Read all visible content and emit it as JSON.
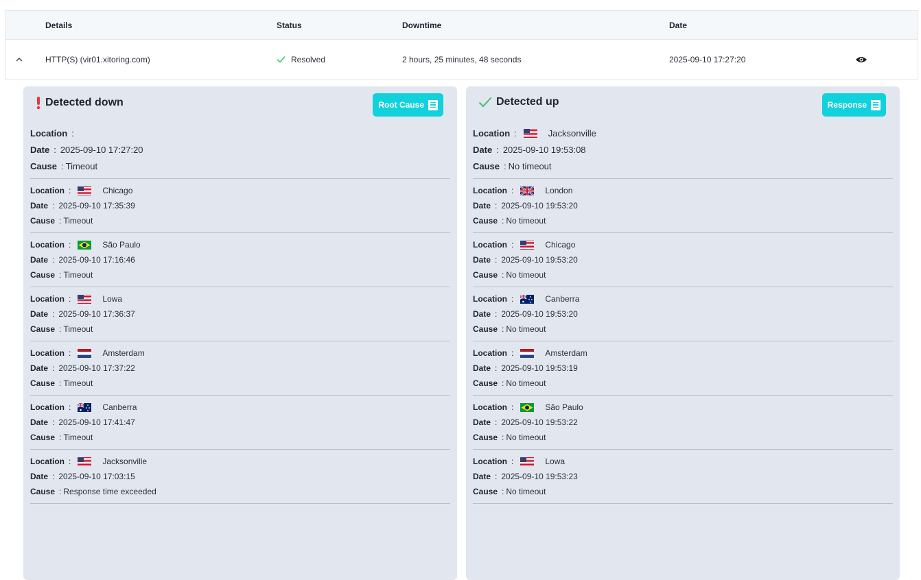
{
  "table": {
    "headers": {
      "details": "Details",
      "status": "Status",
      "downtime": "Downtime",
      "date": "Date"
    },
    "row": {
      "details": "HTTP(S) (vir01.xitoring.com)",
      "status": "Resolved",
      "downtime": "2 hours, 25 minutes, 48 seconds",
      "date": "2025-09-10 17:27:20",
      "expand_icon": "chevron-up-icon",
      "view_icon": "eye-icon",
      "status_icon": "check-icon"
    }
  },
  "labels": {
    "location": "Location",
    "date": "Date",
    "cause": "Cause",
    "sep": ":"
  },
  "down": {
    "title": "Detected down",
    "button": "Root Cause",
    "icon": "exclamation-icon",
    "entries": [
      {
        "location": "",
        "flag": "",
        "date": "2025-09-10 17:27:20",
        "cause": "Timeout"
      },
      {
        "location": "Chicago",
        "flag": "us",
        "date": "2025-09-10 17:35:39",
        "cause": "Timeout"
      },
      {
        "location": "São Paulo",
        "flag": "br",
        "date": "2025-09-10 17:16:46",
        "cause": "Timeout"
      },
      {
        "location": "Lowa",
        "flag": "us",
        "date": "2025-09-10 17:36:37",
        "cause": "Timeout"
      },
      {
        "location": "Amsterdam",
        "flag": "nl",
        "date": "2025-09-10 17:37:22",
        "cause": "Timeout"
      },
      {
        "location": "Canberra",
        "flag": "au",
        "date": "2025-09-10 17:41:47",
        "cause": "Timeout"
      },
      {
        "location": "Jacksonville",
        "flag": "us",
        "date": "2025-09-10 17:03:15",
        "cause": "Response time exceeded"
      }
    ]
  },
  "up": {
    "title": "Detected up",
    "button": "Response",
    "icon": "check-icon",
    "entries": [
      {
        "location": "Jacksonville",
        "flag": "us",
        "date": "2025-09-10 19:53:08",
        "cause": "No timeout"
      },
      {
        "location": "London",
        "flag": "gb",
        "date": "2025-09-10 19:53:20",
        "cause": "No timeout"
      },
      {
        "location": "Chicago",
        "flag": "us",
        "date": "2025-09-10 19:53:20",
        "cause": "No timeout"
      },
      {
        "location": "Canberra",
        "flag": "au",
        "date": "2025-09-10 19:53:20",
        "cause": "No timeout"
      },
      {
        "location": "Amsterdam",
        "flag": "nl",
        "date": "2025-09-10 19:53:19",
        "cause": "No timeout"
      },
      {
        "location": "São Paulo",
        "flag": "br",
        "date": "2025-09-10 19:53:22",
        "cause": "No timeout"
      },
      {
        "location": "Lowa",
        "flag": "us",
        "date": "2025-09-10 19:53:23",
        "cause": "No timeout"
      }
    ]
  },
  "colors": {
    "accent": "#11d2dc",
    "success": "#3fbf6f",
    "danger": "#e53935",
    "panel": "#e2e6ef"
  }
}
